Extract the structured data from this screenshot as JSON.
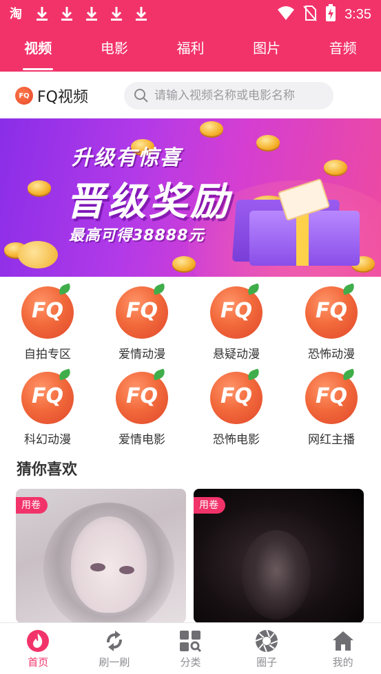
{
  "status_bar": {
    "time": "3:35",
    "left_icons": [
      "taobao-icon",
      "download-icon",
      "download-icon",
      "download-icon",
      "download-icon",
      "download-icon"
    ],
    "right_icons": [
      "wifi-icon",
      "no-sim-icon",
      "battery-charging-icon"
    ],
    "taobao_glyph": "淘"
  },
  "tabs": [
    {
      "label": "视频",
      "active": true
    },
    {
      "label": "电影",
      "active": false
    },
    {
      "label": "福利",
      "active": false
    },
    {
      "label": "图片",
      "active": false
    },
    {
      "label": "音频",
      "active": false
    }
  ],
  "header": {
    "logo_text": "FQ",
    "app_name": "FQ视频",
    "search_placeholder": "请输入视频名称或电影名称"
  },
  "banner": {
    "line1": "升级有惊喜",
    "line2": "晋级奖励",
    "line3": "最高可得38888元"
  },
  "categories": [
    {
      "icon_text": "FQ",
      "label": "自拍专区"
    },
    {
      "icon_text": "FQ",
      "label": "爱情动漫"
    },
    {
      "icon_text": "FQ",
      "label": "悬疑动漫"
    },
    {
      "icon_text": "FQ",
      "label": "恐怖动漫"
    },
    {
      "icon_text": "FQ",
      "label": "科幻动漫"
    },
    {
      "icon_text": "FQ",
      "label": "爱情电影"
    },
    {
      "icon_text": "FQ",
      "label": "恐怖电影"
    },
    {
      "icon_text": "FQ",
      "label": "网红主播"
    }
  ],
  "section": {
    "title": "猜你喜欢"
  },
  "cards": [
    {
      "tag": "用卷"
    },
    {
      "tag": "用卷"
    }
  ],
  "bottom_nav": [
    {
      "label": "首页",
      "icon": "home-flame-icon",
      "active": true
    },
    {
      "label": "刷一刷",
      "icon": "refresh-icon",
      "active": false
    },
    {
      "label": "分类",
      "icon": "category-grid-icon",
      "active": false
    },
    {
      "label": "圈子",
      "icon": "aperture-icon",
      "active": false
    },
    {
      "label": "我的",
      "icon": "house-icon",
      "active": false
    }
  ],
  "colors": {
    "brand": "#f2336a",
    "inactive": "#8e8e93",
    "logo_orange": "#f26a3c"
  }
}
